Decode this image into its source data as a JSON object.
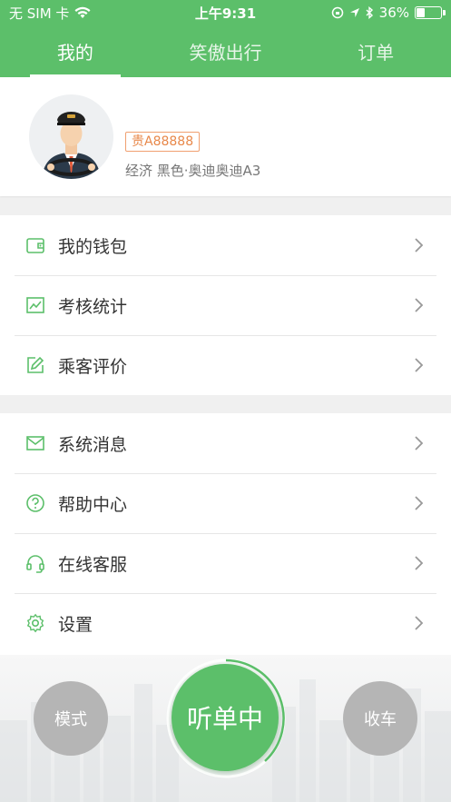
{
  "status_bar": {
    "carrier": "无 SIM 卡",
    "time": "上午9:31",
    "battery": "36%",
    "battery_level": 0.36
  },
  "tabs": [
    {
      "label": "我的",
      "active": true
    },
    {
      "label": "笑傲出行",
      "active": false
    },
    {
      "label": "订单",
      "active": false
    }
  ],
  "profile": {
    "plate": "贵A88888",
    "car_info": "经济 黑色·奥迪奥迪A3"
  },
  "menu_group_1": [
    {
      "label": "我的钱包",
      "icon": "wallet-icon"
    },
    {
      "label": "考核统计",
      "icon": "chart-icon"
    },
    {
      "label": "乘客评价",
      "icon": "edit-icon"
    }
  ],
  "menu_group_2": [
    {
      "label": "系统消息",
      "icon": "mail-icon"
    },
    {
      "label": "帮助中心",
      "icon": "help-icon"
    },
    {
      "label": "在线客服",
      "icon": "headset-icon"
    },
    {
      "label": "设置",
      "icon": "gear-icon"
    }
  ],
  "bottom": {
    "mode_label": "模式",
    "listening_label": "听单中",
    "stop_label": "收车"
  },
  "colors": {
    "brand_green": "#5cbf6a",
    "plate_orange": "#e8884a",
    "gray_button": "#b5b5b5"
  }
}
